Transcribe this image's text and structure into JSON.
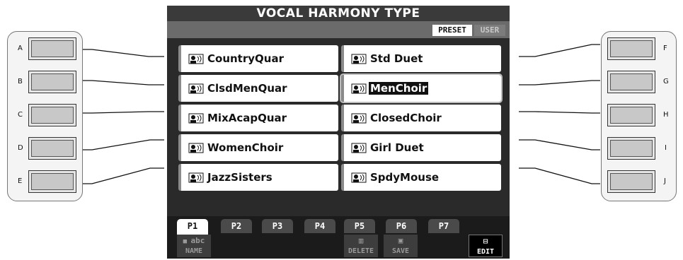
{
  "screen": {
    "title": "VOCAL HARMONY TYPE",
    "tabs": {
      "preset": "PRESET",
      "user": "USER"
    }
  },
  "left_buttons": [
    "A",
    "B",
    "C",
    "D",
    "E"
  ],
  "right_buttons": [
    "F",
    "G",
    "H",
    "I",
    "J"
  ],
  "items_left": [
    "CountryQuar",
    "ClsdMenQuar",
    "MixAcapQuar",
    "WomenChoir",
    "JazzSisters"
  ],
  "items_right": [
    "Std Duet",
    "MenChoir",
    "ClosedChoir",
    "Girl Duet",
    "SpdyMouse"
  ],
  "selected_item": "MenChoir",
  "page_tabs": [
    "P1",
    "P2",
    "P3",
    "P4",
    "P5",
    "P6",
    "P7"
  ],
  "active_page": "P1",
  "function_buttons": {
    "name": {
      "icon_text": "abc",
      "label": "NAME"
    },
    "delete": {
      "label": "DELETE"
    },
    "save": {
      "label": "SAVE"
    },
    "edit": {
      "label": "EDIT"
    }
  },
  "icons": {
    "item_icon": "vocal-harmony-person-icon"
  }
}
